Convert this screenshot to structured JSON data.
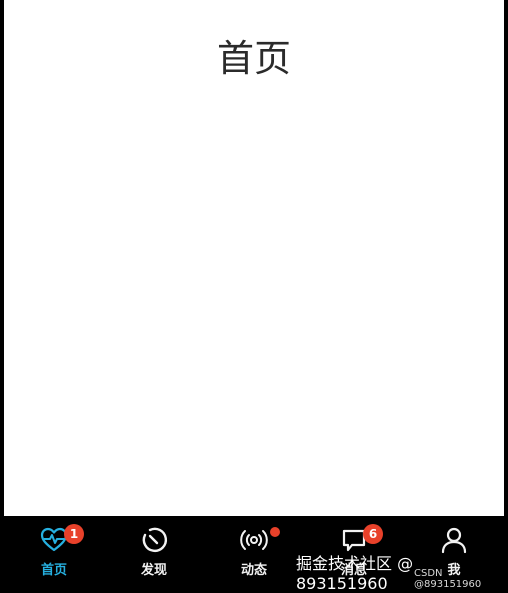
{
  "page": {
    "title": "首页"
  },
  "tabbar": {
    "active_color": "#26b0e0",
    "badge_color": "#e8412a",
    "items": [
      {
        "label": "首页",
        "icon": "heart-pulse-icon",
        "badge": "1"
      },
      {
        "label": "发现",
        "icon": "compass-icon"
      },
      {
        "label": "动态",
        "icon": "broadcast-icon",
        "has_dot": true
      },
      {
        "label": "消息",
        "icon": "message-icon",
        "badge": "6"
      },
      {
        "label": "我",
        "icon": "user-icon"
      }
    ]
  },
  "watermark": {
    "main": "掘金技术社区 @ 893151960",
    "sub": "CSDN @893151960"
  }
}
